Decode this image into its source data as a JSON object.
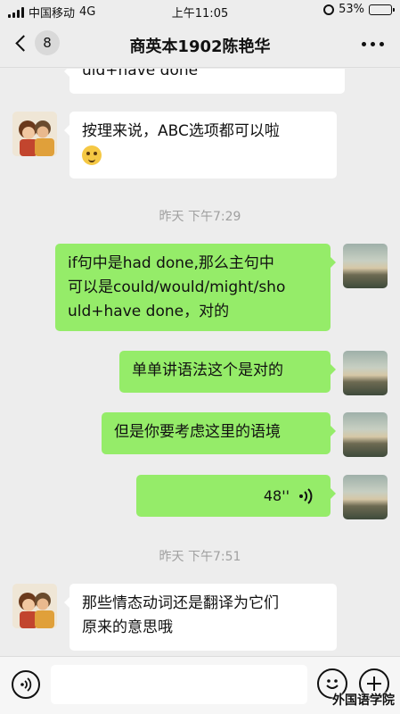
{
  "status_bar": {
    "carrier": "中国移动",
    "network": "4G",
    "time": "上午11:05",
    "battery": "53%",
    "battery_level": 0.53,
    "icons": [
      "signal-icon",
      "alarm-icon",
      "battery-icon"
    ]
  },
  "nav": {
    "unread_count": "8",
    "title": "商英本1902陈艳华",
    "icons": [
      "chevron-left-icon",
      "more-icon"
    ]
  },
  "messages": [
    {
      "side": "in",
      "text": "uld+have  done"
    },
    {
      "side": "in",
      "text": "按理来说，ABC选项都可以啦"
    },
    {
      "type": "timestamp",
      "text": "昨天 下午7:29"
    },
    {
      "side": "out",
      "lines": [
        "if句中是had  done,那么主句中",
        "可以是could/would/might/sho",
        "uld+have  done，对的"
      ]
    },
    {
      "side": "out",
      "text": "单单讲语法这个是对的"
    },
    {
      "side": "out",
      "text": "但是你要考虑这里的语境"
    },
    {
      "side": "out",
      "type": "voice",
      "duration": "48''"
    },
    {
      "type": "timestamp",
      "text": "昨天 下午7:51"
    },
    {
      "side": "in",
      "lines": [
        "那些情态动词还是翻译为它们",
        "原来的意思哦"
      ]
    }
  ],
  "input_bar": {
    "icons": [
      "voice-icon",
      "emoji-icon",
      "plus-icon"
    ]
  },
  "watermark": "外国语学院",
  "colors": {
    "background": "#ededed",
    "outgoing_bubble": "#95ec69",
    "incoming_bubble": "#ffffff"
  }
}
